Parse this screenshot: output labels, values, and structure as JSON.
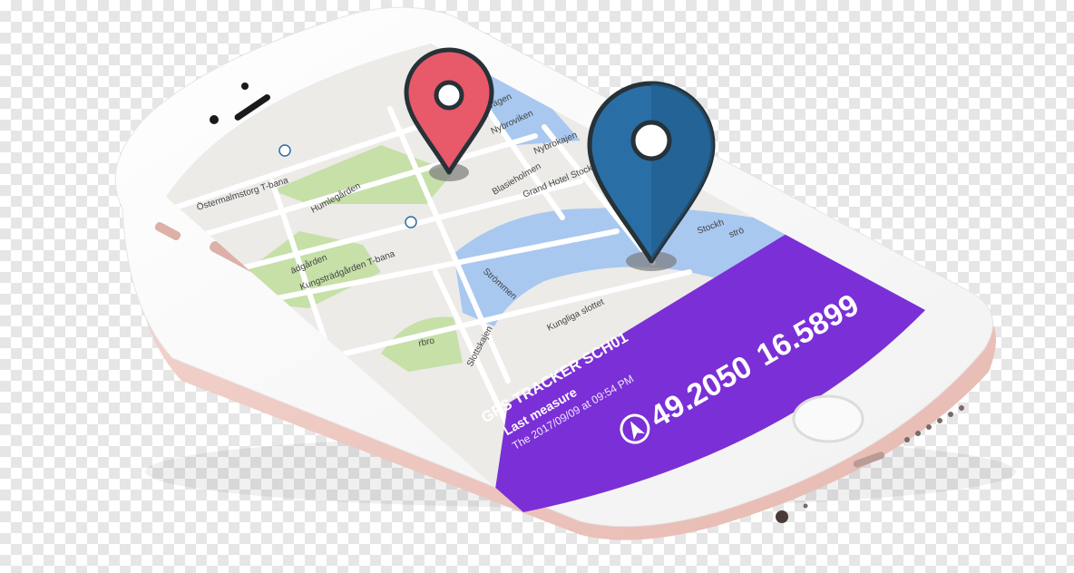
{
  "app": {
    "tracker_name": "GPS TRACKER SCH01",
    "last_measure_label": "Last measure",
    "last_measure_time": "The 2017/09/09 at 09:54 PM",
    "latitude": "49.2050",
    "longitude": "16.5899"
  },
  "map": {
    "labels": {
      "ostermalmstorg": "Östermalmstorg T-bana",
      "humlegarden": "Humlegården",
      "nybroviken": "Nybroviken",
      "nybrokajen": "Nybrokajen",
      "blasieholmen": "Blasieholmen",
      "grand_hotel": "Grand Hotel Stockholm",
      "kungstradgarden": "Kungsträdgården T-bana",
      "tradgarden": "ädgården",
      "strommen": "Strömmen",
      "kungliga_slottet": "Kungliga slottet",
      "slottskajen": "Slottskajen",
      "stockholm": "Stockh",
      "stro": "strö",
      "arbro": "rbro",
      "vagen": "vägen"
    }
  },
  "pins": [
    {
      "name": "origin",
      "color": "#e8596a"
    },
    {
      "name": "current",
      "color": "#2a6ea6"
    }
  ],
  "colors": {
    "panel": "#7b2fd6",
    "water": "#a8c8f0",
    "park": "#c6e0a8",
    "map_bg": "#ecebe8",
    "phone_body": "#eec7c0"
  }
}
